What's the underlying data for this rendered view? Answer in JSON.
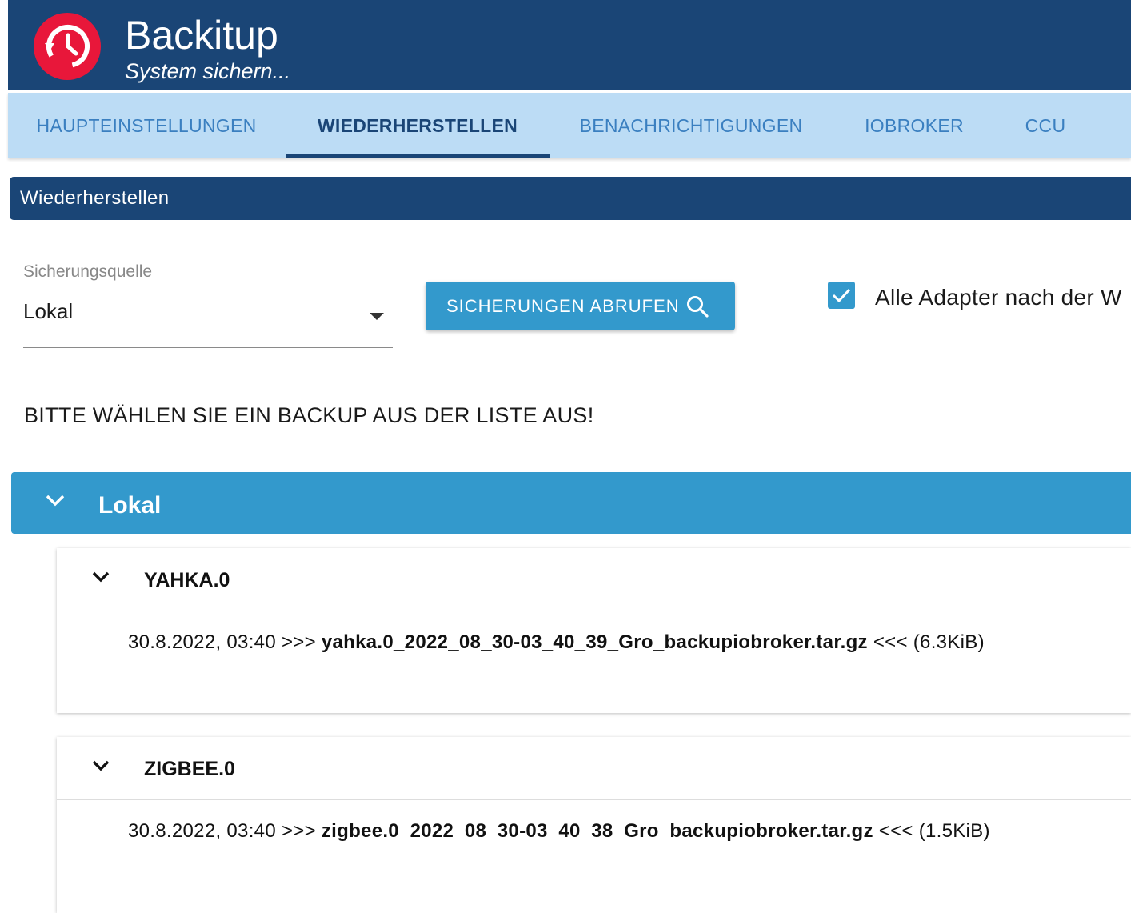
{
  "header": {
    "title": "Backitup",
    "subtitle": "System sichern..."
  },
  "tabs": [
    {
      "label": "HAUPTEINSTELLUNGEN",
      "active": false
    },
    {
      "label": "WIEDERHERSTELLEN",
      "active": true
    },
    {
      "label": "BENACHRICHTIGUNGEN",
      "active": false
    },
    {
      "label": "IOBROKER",
      "active": false
    },
    {
      "label": "CCU",
      "active": false
    }
  ],
  "section": {
    "title": "Wiederherstellen"
  },
  "source_select": {
    "label": "Sicherungsquelle",
    "value": "Lokal"
  },
  "fetch_button": {
    "label": "SICHERUNGEN ABRUFEN",
    "icon": "search-icon"
  },
  "restart_checkbox": {
    "checked": true,
    "label": "Alle Adapter nach der W"
  },
  "instruction": "BITTE WÄHLEN SIE EIN BACKUP AUS DER LISTE AUS!",
  "backup_group": {
    "title": "Lokal",
    "items": [
      {
        "name": "YAHKA.0",
        "date": "30.8.2022, 03:40",
        "prefix": ">>>",
        "file": "yahka.0_2022_08_30-03_40_39_Gro_backupiobroker.tar.gz",
        "suffix": "<<<",
        "size": "(6.3KiB)"
      },
      {
        "name": "ZIGBEE.0",
        "date": "30.8.2022, 03:40",
        "prefix": ">>>",
        "file": "zigbee.0_2022_08_30-03_40_38_Gro_backupiobroker.tar.gz",
        "suffix": "<<<",
        "size": "(1.5KiB)"
      }
    ]
  },
  "colors": {
    "header": "#1a4576",
    "tabs_bg": "#bcdcf5",
    "tab_text": "#3a7fc0",
    "accent": "#3399cc",
    "logo": "#e8173a"
  }
}
